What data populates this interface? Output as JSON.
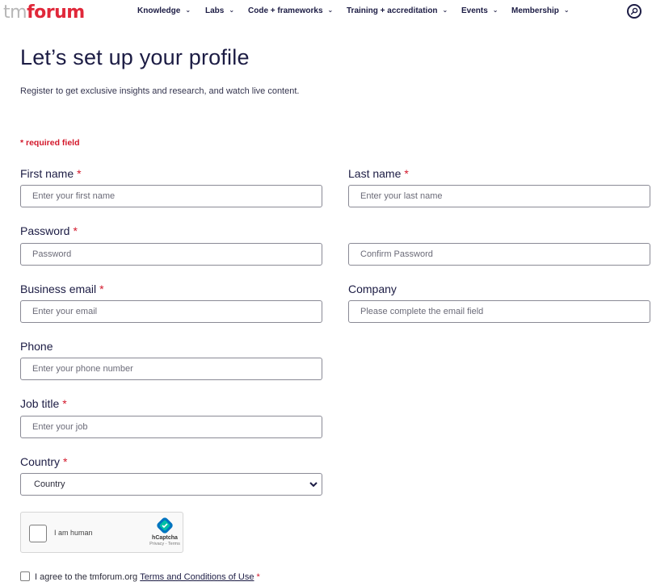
{
  "brand": {
    "logo_tm": "tm",
    "logo_forum": "forum"
  },
  "nav": {
    "items": [
      {
        "label": "Knowledge"
      },
      {
        "label": "Labs"
      },
      {
        "label": "Code + frameworks"
      },
      {
        "label": "Training + accreditation"
      },
      {
        "label": "Events"
      },
      {
        "label": "Membership"
      }
    ],
    "chevron": "⌄"
  },
  "page": {
    "title": "Let’s set up your profile",
    "intro": "Register to get exclusive insights and research, and watch live content.",
    "required_note": "* required field"
  },
  "form": {
    "required_marker": "*",
    "first_name": {
      "label": "First name",
      "placeholder": "Enter your first name"
    },
    "last_name": {
      "label": "Last name",
      "placeholder": "Enter your last name"
    },
    "password": {
      "label": "Password",
      "placeholder": "Password"
    },
    "confirm_password": {
      "placeholder": "Confirm Password"
    },
    "business_email": {
      "label": "Business email",
      "placeholder": "Enter your email"
    },
    "company": {
      "label": "Company",
      "placeholder": "Please complete the email field"
    },
    "phone": {
      "label": "Phone",
      "placeholder": "Enter your phone number"
    },
    "job_title": {
      "label": "Job title",
      "placeholder": "Enter your job"
    },
    "country": {
      "label": "Country",
      "selected": "Country"
    }
  },
  "captcha": {
    "text": "I am human",
    "brand": "hCaptcha",
    "links": "Privacy - Terms"
  },
  "agree": {
    "text": "I agree to the tmforum.org",
    "link": "Terms and Conditions of Use"
  }
}
